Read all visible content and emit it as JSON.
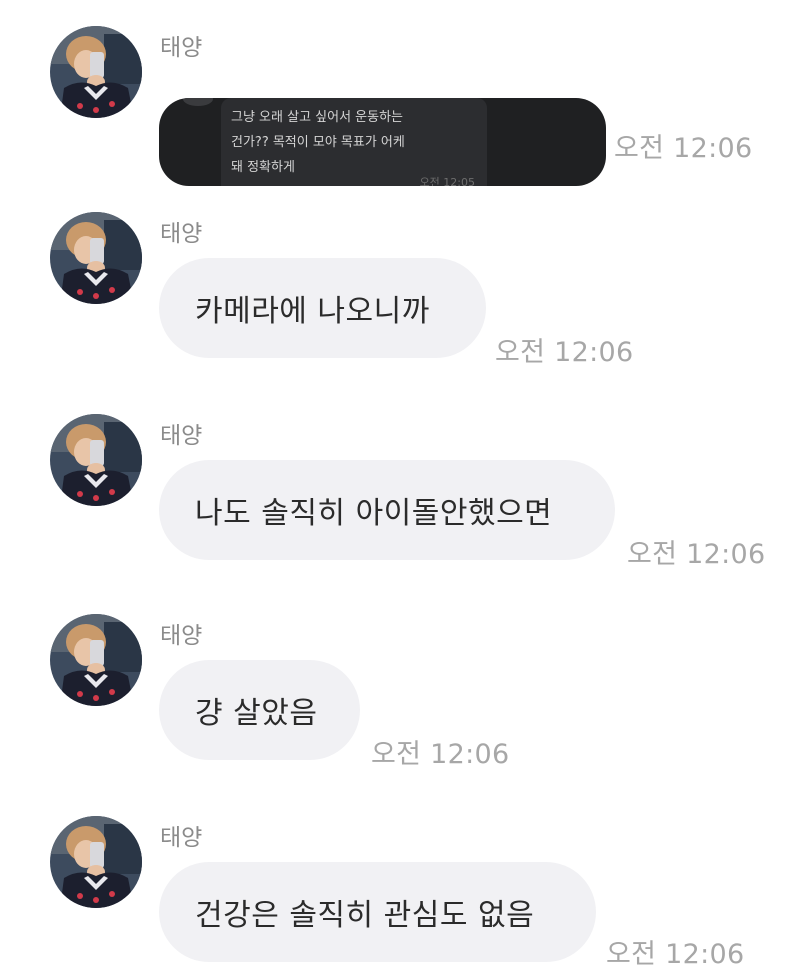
{
  "messages": [
    {
      "sender": "태양",
      "type": "image",
      "image_lines": [
        "그냥 오래 살고 싶어서 운동하는",
        "건가?? 목적이 모야 목표가 어케",
        "돼 정확하게"
      ],
      "image_time": "오전 12:05",
      "time": "오전 12:06"
    },
    {
      "sender": "태양",
      "type": "text",
      "text": "카메라에 나오니까",
      "time": "오전 12:06"
    },
    {
      "sender": "태양",
      "type": "text",
      "text": "나도 솔직히 아이돌안했으면",
      "time": "오전 12:06"
    },
    {
      "sender": "태양",
      "type": "text",
      "text": "걍 살았음",
      "time": "오전 12:06"
    },
    {
      "sender": "태양",
      "type": "text",
      "text": "건강은 솔직히 관심도 없음",
      "time": "오전 12:06"
    }
  ],
  "colors": {
    "bubble": "#f1f1f4",
    "sender": "#8b8b8b",
    "time": "#a7a7a7",
    "text": "#2b2b2b",
    "dark_bubble": "#1f2022"
  },
  "icons": {
    "avatar": "profile-photo"
  }
}
